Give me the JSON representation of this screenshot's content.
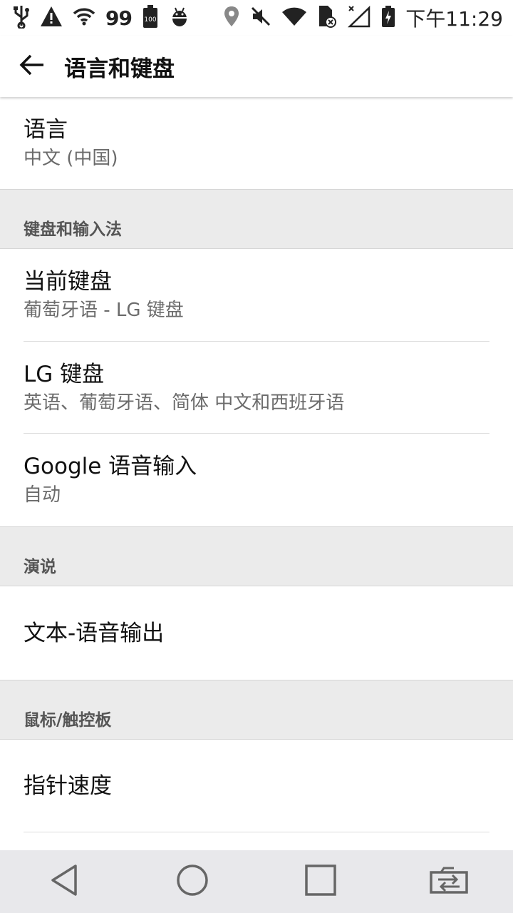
{
  "status_bar": {
    "left_icons": [
      "usb-icon",
      "warning-icon",
      "wifi-icon",
      "battery-full-icon",
      "android-debug-icon"
    ],
    "notification_count": "99",
    "right_icons": [
      "location-icon",
      "mute-icon",
      "wifi-signal-icon",
      "sim-error-icon",
      "cell-signal-icon",
      "battery-charging-icon"
    ],
    "time": "下午11:29"
  },
  "appbar": {
    "back_icon": "arrow-back-icon",
    "title": "语言和键盘"
  },
  "items": {
    "language": {
      "title": "语言",
      "subtitle": "中文 (中国)"
    },
    "current_keyboard": {
      "title": "当前键盘",
      "subtitle": "葡萄牙语 - LG 键盘"
    },
    "lg_keyboard": {
      "title": "LG 键盘",
      "subtitle": "英语、葡萄牙语、简体 中文和西班牙语"
    },
    "google_voice": {
      "title": "Google 语音输入",
      "subtitle": "自动"
    },
    "tts": {
      "title": "文本-语音输出"
    },
    "pointer_speed": {
      "title": "指针速度"
    }
  },
  "sections": {
    "keyboard_input": "键盘和输入法",
    "speech": "演说",
    "mouse": "鼠标/触控板"
  },
  "navbar": {
    "buttons": [
      "back-triangle-icon",
      "home-circle-icon",
      "recents-square-icon",
      "switch-sim-icon"
    ]
  },
  "colors": {
    "section_bg": "#ebebeb",
    "navbar_bg": "#e8e8eb",
    "subtitle": "#6b6b6b"
  }
}
